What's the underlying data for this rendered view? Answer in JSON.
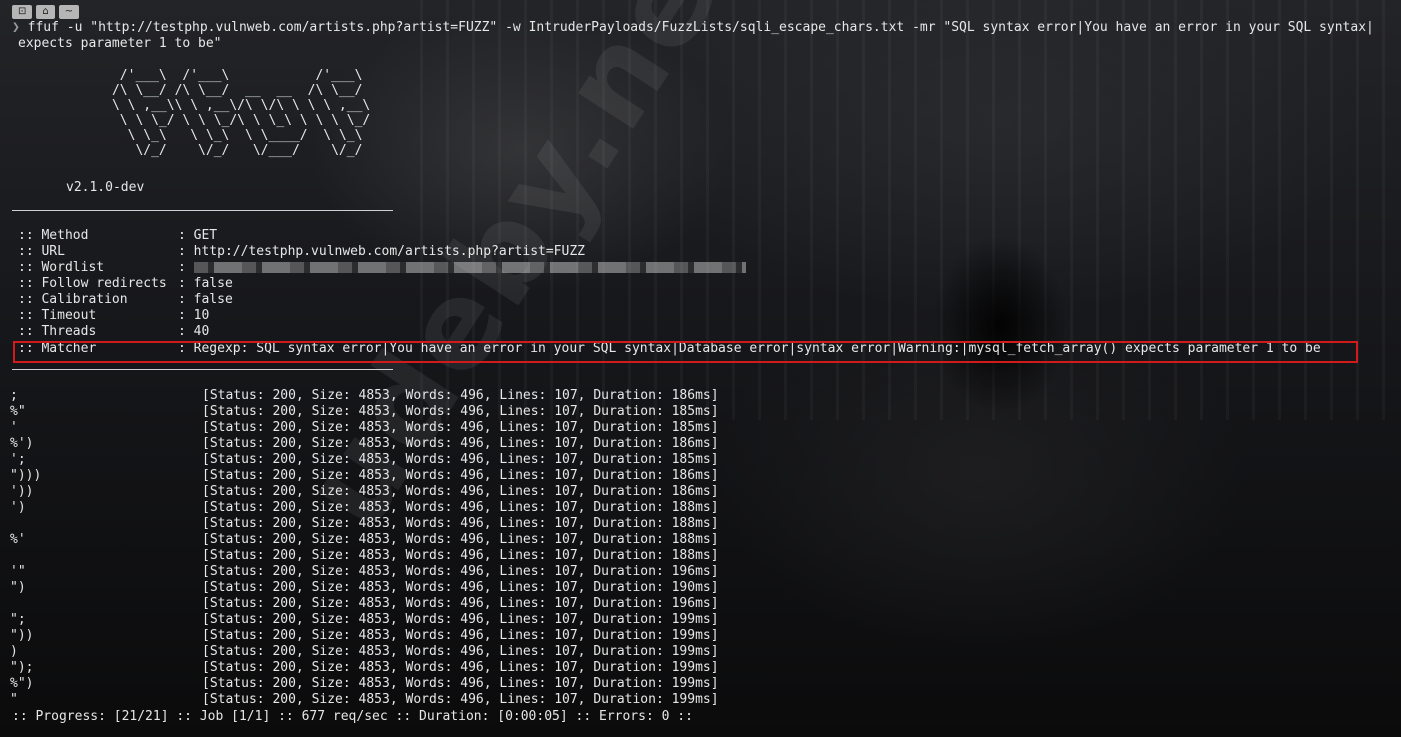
{
  "terminal": {
    "tabbar": {
      "segments": [
        "⊡",
        "",
        "~"
      ]
    },
    "command_line1": "ffuf -u \"http://testphp.vulnweb.com/artists.php?artist=FUZZ\" -w IntruderPayloads/FuzzLists/sqli_escape_chars.txt -mr \"SQL syntax error|You have an error in your SQL syntax|",
    "command_line2": "expects parameter 1 to be\"",
    "banner": [
      "       /'___\\  /'___\\           /'___\\",
      "      /\\ \\__/ /\\ \\__/  __  __  /\\ \\__/",
      "      \\ \\ ,__\\\\ \\ ,__\\/\\ \\/\\ \\ \\ \\ ,__\\",
      "       \\ \\ \\_/ \\ \\ \\_/\\ \\ \\_\\ \\ \\ \\ \\_/",
      "        \\ \\_\\   \\ \\_\\  \\ \\____/  \\ \\_\\",
      "         \\/_/    \\/_/   \\/___/    \\/_/"
    ],
    "version": "v2.1.0-dev",
    "config": [
      {
        "key": ":: Method",
        "value": ": GET"
      },
      {
        "key": ":: URL",
        "value": ": http://testphp.vulnweb.com/artists.php?artist=FUZZ"
      },
      {
        "key": ":: Wordlist",
        "value": ":"
      },
      {
        "key": ":: Follow redirects",
        "value": ": false"
      },
      {
        "key": ":: Calibration",
        "value": ": false"
      },
      {
        "key": ":: Timeout",
        "value": ": 10"
      },
      {
        "key": ":: Threads",
        "value": ": 40"
      },
      {
        "key": ":: Matcher",
        "value": ": Regexp: SQL syntax error|You have an error in your SQL syntax|Database error|syntax error|Warning:|mysql_fetch_array() expects parameter 1 to be"
      }
    ],
    "results": [
      {
        "payload": ";",
        "status": "[Status: 200, Size: 4853, Words: 496, Lines: 107, Duration: 186ms]"
      },
      {
        "payload": "%\"",
        "status": "[Status: 200, Size: 4853, Words: 496, Lines: 107, Duration: 185ms]"
      },
      {
        "payload": "'",
        "status": "[Status: 200, Size: 4853, Words: 496, Lines: 107, Duration: 185ms]"
      },
      {
        "payload": "%')",
        "status": "[Status: 200, Size: 4853, Words: 496, Lines: 107, Duration: 186ms]"
      },
      {
        "payload": "';",
        "status": "[Status: 200, Size: 4853, Words: 496, Lines: 107, Duration: 185ms]"
      },
      {
        "payload": "\")))",
        "status": "[Status: 200, Size: 4853, Words: 496, Lines: 107, Duration: 186ms]"
      },
      {
        "payload": "'))",
        "status": "[Status: 200, Size: 4853, Words: 496, Lines: 107, Duration: 186ms]"
      },
      {
        "payload": "')",
        "status": "[Status: 200, Size: 4853, Words: 496, Lines: 107, Duration: 188ms]"
      },
      {
        "payload": "",
        "status": "[Status: 200, Size: 4853, Words: 496, Lines: 107, Duration: 188ms]"
      },
      {
        "payload": "%'",
        "status": "[Status: 200, Size: 4853, Words: 496, Lines: 107, Duration: 188ms]"
      },
      {
        "payload": "",
        "status": "[Status: 200, Size: 4853, Words: 496, Lines: 107, Duration: 188ms]"
      },
      {
        "payload": "'\"",
        "status": "[Status: 200, Size: 4853, Words: 496, Lines: 107, Duration: 196ms]"
      },
      {
        "payload": "\")",
        "status": "[Status: 200, Size: 4853, Words: 496, Lines: 107, Duration: 190ms]"
      },
      {
        "payload": "",
        "status": "[Status: 200, Size: 4853, Words: 496, Lines: 107, Duration: 196ms]"
      },
      {
        "payload": "\";",
        "status": "[Status: 200, Size: 4853, Words: 496, Lines: 107, Duration: 199ms]"
      },
      {
        "payload": "\"))",
        "status": "[Status: 200, Size: 4853, Words: 496, Lines: 107, Duration: 199ms]"
      },
      {
        "payload": ")",
        "status": "[Status: 200, Size: 4853, Words: 496, Lines: 107, Duration: 199ms]"
      },
      {
        "payload": "\");",
        "status": "[Status: 200, Size: 4853, Words: 496, Lines: 107, Duration: 199ms]"
      },
      {
        "payload": "%\")",
        "status": "[Status: 200, Size: 4853, Words: 496, Lines: 107, Duration: 199ms]"
      },
      {
        "payload": "\"",
        "status": "[Status: 200, Size: 4853, Words: 496, Lines: 107, Duration: 199ms]"
      }
    ],
    "footer": ":: Progress: [21/21] :: Job [1/1] :: 677 req/sec :: Duration: [0:00:05] :: Errors: 0 ::",
    "watermark": "udeby.net",
    "highlight_color": "#d21a1a"
  }
}
